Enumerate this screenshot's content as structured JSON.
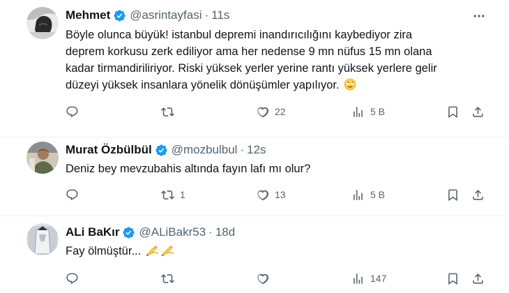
{
  "tweets": [
    {
      "name": "Mehmet",
      "handle": "@asrintayfasi",
      "time": "11s",
      "text_lines": [
        "Böyle olunca büyük! istanbul depremi inandırıcılığını kaybediyor zira",
        "deprem korkusu zerk ediliyor ama her nedense 9 mn nüfus 15 mn olana",
        "kadar tirmandiriliriyor. Riski yüksek yerler yerine rantı yüksek yerlere gelir",
        "düzeyi yüksek insanlara yönelik dönüşümler yapılıyor."
      ],
      "emoji": "rolling-eyes-face-emoji",
      "stats": {
        "replies": "",
        "retweets": "",
        "likes": "22",
        "views": "5 B"
      }
    },
    {
      "name": "Murat Özbülbül",
      "handle": "@mozbulbul",
      "time": "12s",
      "text_lines": [
        "Deniz bey mevzubahis altında fayın lafı mı olur?"
      ],
      "stats": {
        "replies": "",
        "retweets": "1",
        "likes": "13",
        "views": "5 B"
      }
    },
    {
      "name": "ALi BaKır",
      "handle": "@ALiBakr53",
      "time": "18d",
      "text_lines": [
        "Fay ölmüştür..."
      ],
      "emoji": "writing-hand-emoji",
      "stats": {
        "replies": "",
        "retweets": "",
        "likes": "",
        "views": "147"
      }
    }
  ],
  "icons": {
    "reply": "reply-icon",
    "retweet": "retweet-icon",
    "like": "heart-icon",
    "views": "views-icon",
    "bookmark": "bookmark-icon",
    "share": "share-icon",
    "more": "more-icon",
    "verified": "verified-badge-icon"
  },
  "colors": {
    "text": "#0f1419",
    "secondary": "#536471",
    "verified": "#1d9bf0",
    "divider": "#eff3f4"
  }
}
